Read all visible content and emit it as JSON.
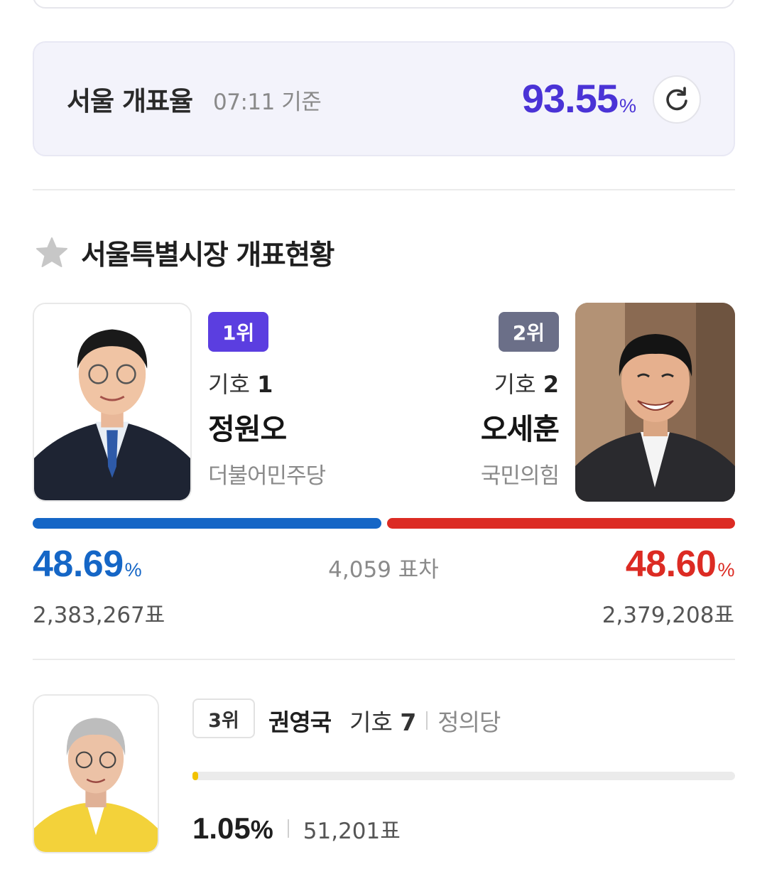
{
  "turnout": {
    "title": "서울 개표율",
    "time": "07:11 기준",
    "value": "93.55",
    "unit": "%",
    "progress_percent": 93.55
  },
  "section": {
    "title": "서울특별시장 개표현황",
    "icon": "star-icon"
  },
  "candidates": [
    {
      "rank": "1위",
      "number_label": "기호",
      "number": "1",
      "name": "정원오",
      "party": "더불어민주당",
      "percent": "48.69",
      "unit": "%",
      "votes": "2,383,267표",
      "color": "#1566c6"
    },
    {
      "rank": "2위",
      "number_label": "기호",
      "number": "2",
      "name": "오세훈",
      "party": "국민의힘",
      "percent": "48.60",
      "unit": "%",
      "votes": "2,379,208표",
      "color": "#dc2b23"
    }
  ],
  "margin": "4,059 표차",
  "third": {
    "rank": "3위",
    "name": "권영국",
    "number_label": "기호",
    "number": "7",
    "party": "정의당",
    "percent": "1.05",
    "unit": "%",
    "votes": "51,201표",
    "percent_value": 1.05,
    "color": "#f2c200"
  },
  "colors": {
    "accent": "#4a33d6",
    "rank1_badge": "#5b3ee0",
    "rank2_badge": "#6b6f88"
  }
}
